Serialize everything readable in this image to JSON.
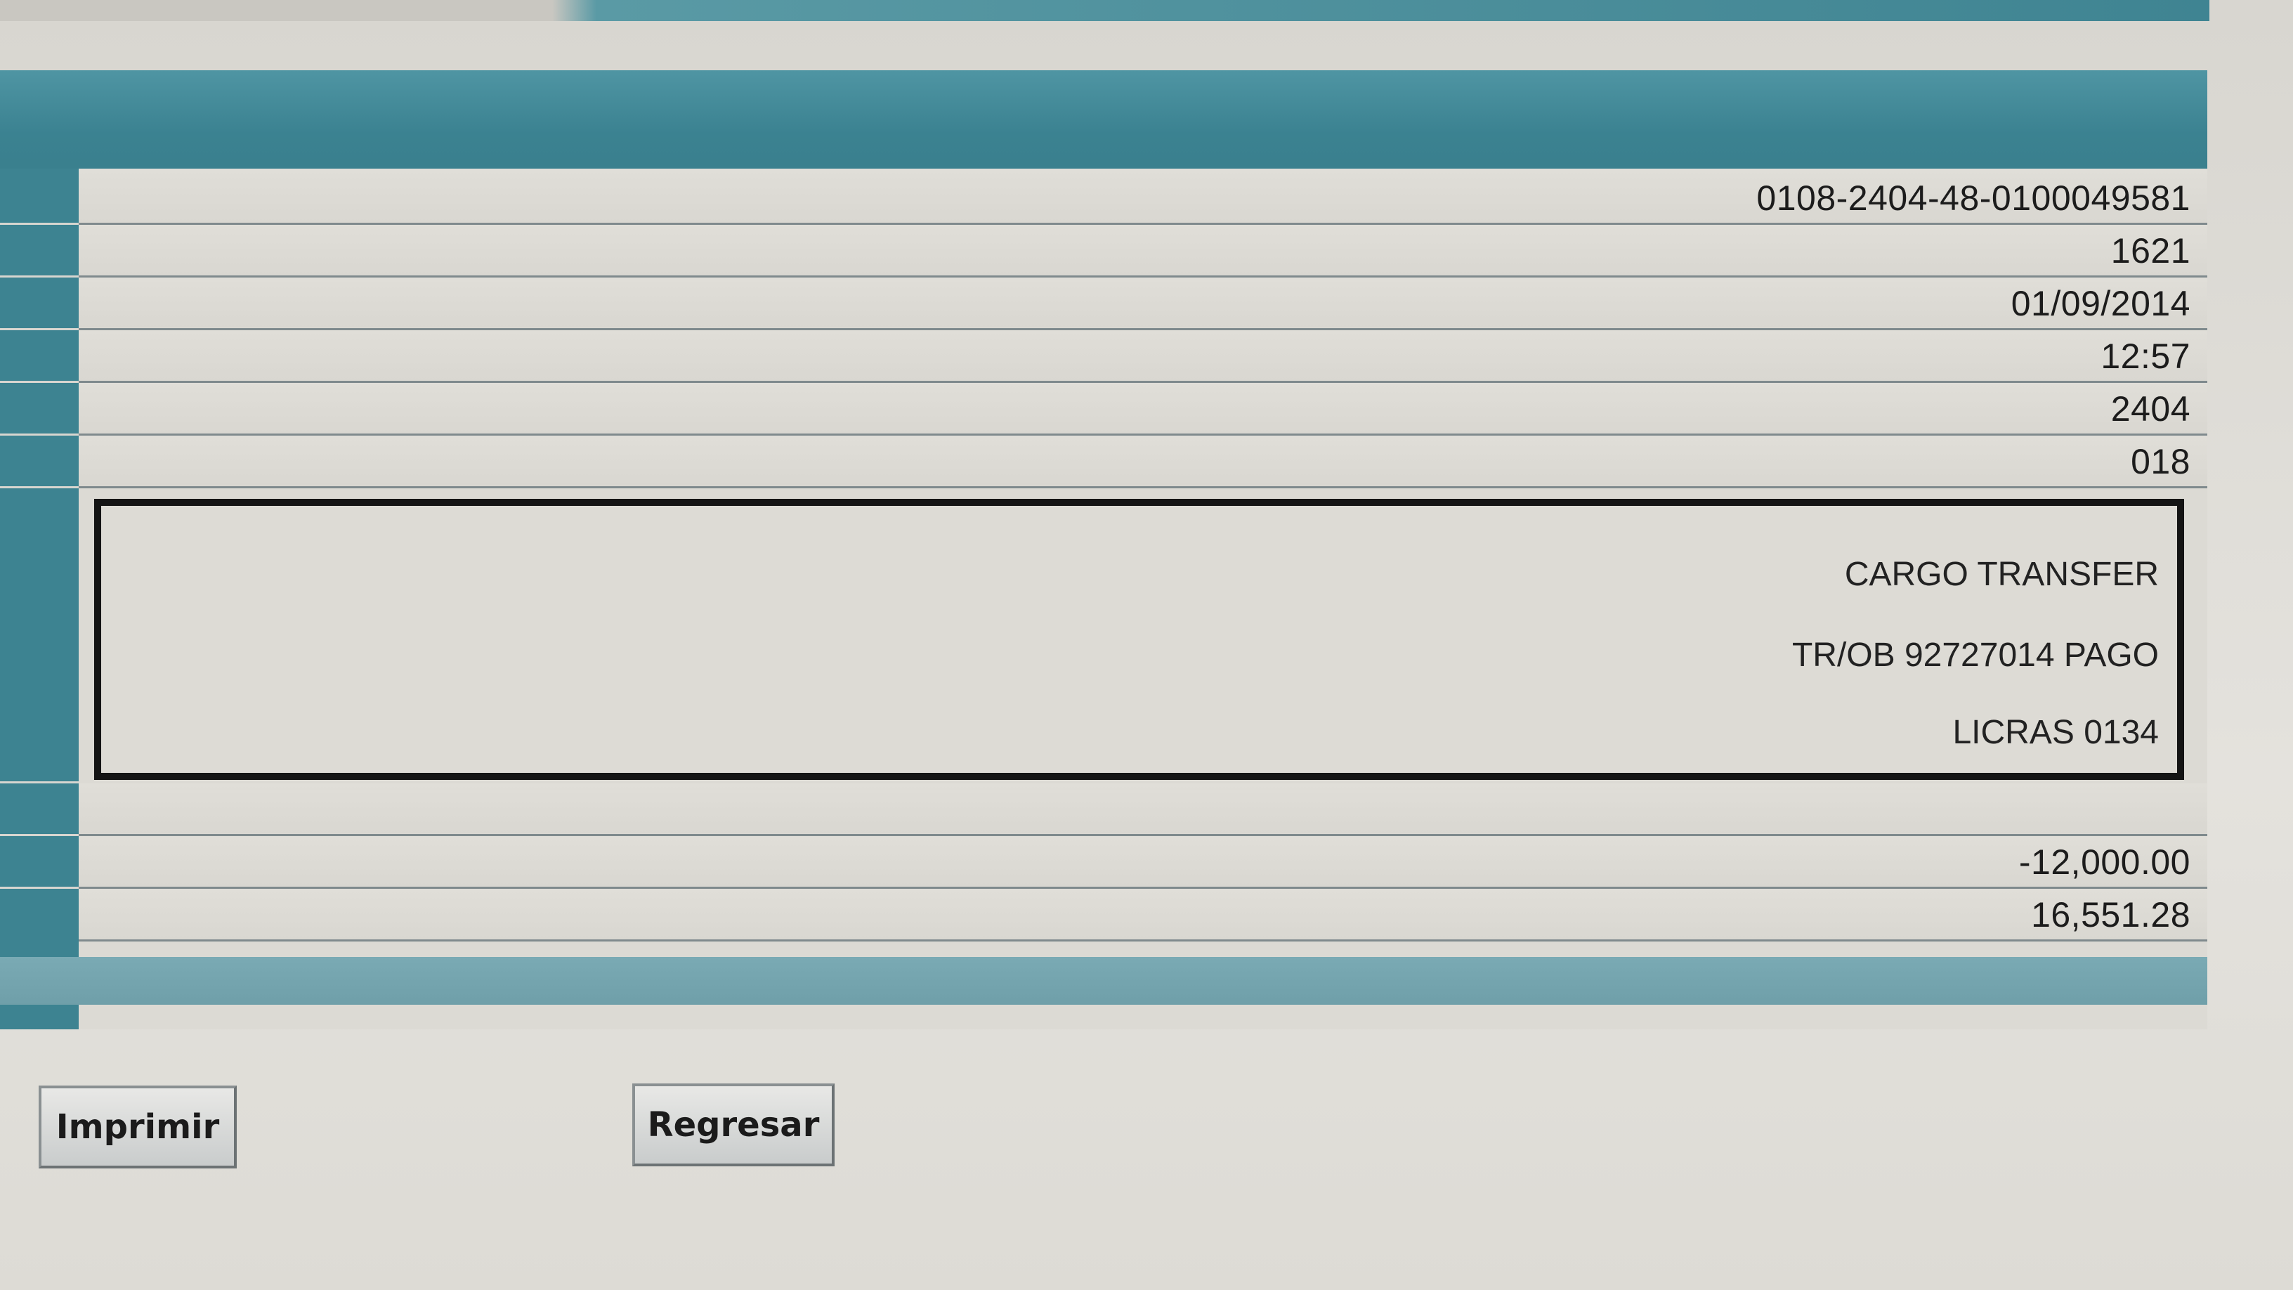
{
  "detail": {
    "values": [
      "0108-2404-48-0100049581",
      "1621",
      "01/09/2014",
      "12:57",
      "2404",
      "018"
    ],
    "description_lines": [
      "CARGO TRANSFER",
      "TR/OB 92727014 PAGO",
      "LICRAS 0134"
    ],
    "empty_row": "",
    "amount": "-12,000.00",
    "balance": "16,551.28"
  },
  "actions": {
    "print_label": "Imprimir",
    "back_label": "Regresar"
  }
}
